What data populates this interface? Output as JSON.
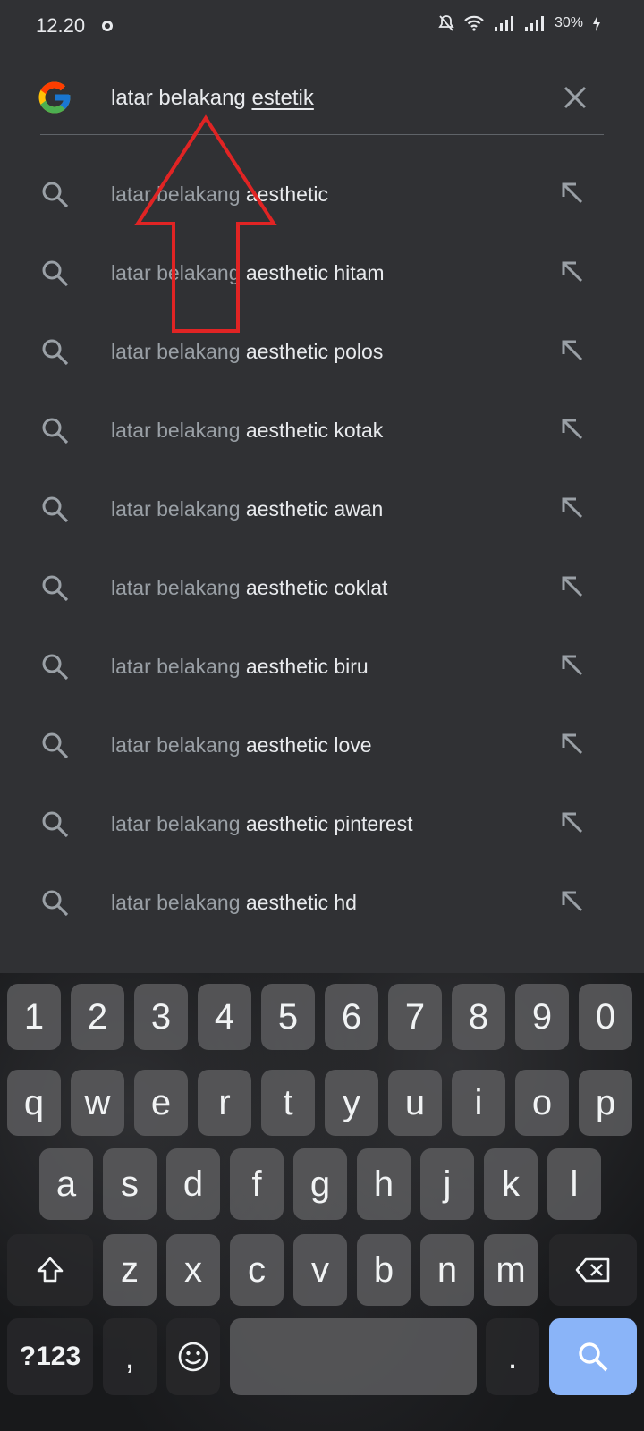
{
  "status_bar": {
    "time": "12.20",
    "battery": "30%"
  },
  "search": {
    "query_prefix": "latar belakang ",
    "query_underlined": "estetik"
  },
  "suggestions": [
    {
      "prefix": "latar belakang ",
      "bold": "aesthetic"
    },
    {
      "prefix": "latar belakang ",
      "bold": "aesthetic hitam"
    },
    {
      "prefix": "latar belakang ",
      "bold": "aesthetic polos"
    },
    {
      "prefix": "latar belakang ",
      "bold": "aesthetic kotak"
    },
    {
      "prefix": "latar belakang ",
      "bold": "aesthetic awan"
    },
    {
      "prefix": "latar belakang ",
      "bold": "aesthetic coklat"
    },
    {
      "prefix": "latar belakang ",
      "bold": "aesthetic biru"
    },
    {
      "prefix": "latar belakang ",
      "bold": "aesthetic love"
    },
    {
      "prefix": "latar belakang ",
      "bold": "aesthetic pinterest"
    },
    {
      "prefix": "latar belakang ",
      "bold": "aesthetic hd"
    }
  ],
  "keyboard": {
    "row_numbers": [
      "1",
      "2",
      "3",
      "4",
      "5",
      "6",
      "7",
      "8",
      "9",
      "0"
    ],
    "row_q": [
      "q",
      "w",
      "e",
      "r",
      "t",
      "y",
      "u",
      "i",
      "o",
      "p"
    ],
    "row_a": [
      "a",
      "s",
      "d",
      "f",
      "g",
      "h",
      "j",
      "k",
      "l"
    ],
    "row_z": [
      "z",
      "x",
      "c",
      "v",
      "b",
      "n",
      "m"
    ],
    "symbols_label": "?123",
    "comma_label": ",",
    "period_label": "."
  },
  "colors": {
    "background": "#303134",
    "annotation_arrow": "#e02424",
    "search_key": "#8ab4f8"
  },
  "icons": {
    "logo": "google-g-logo",
    "clear": "close-icon",
    "suggestion": "search-icon",
    "fill": "arrow-up-left-icon",
    "shift": "shift-icon",
    "backspace": "backspace-icon",
    "emoji": "emoji-icon",
    "search_key": "search-icon"
  }
}
